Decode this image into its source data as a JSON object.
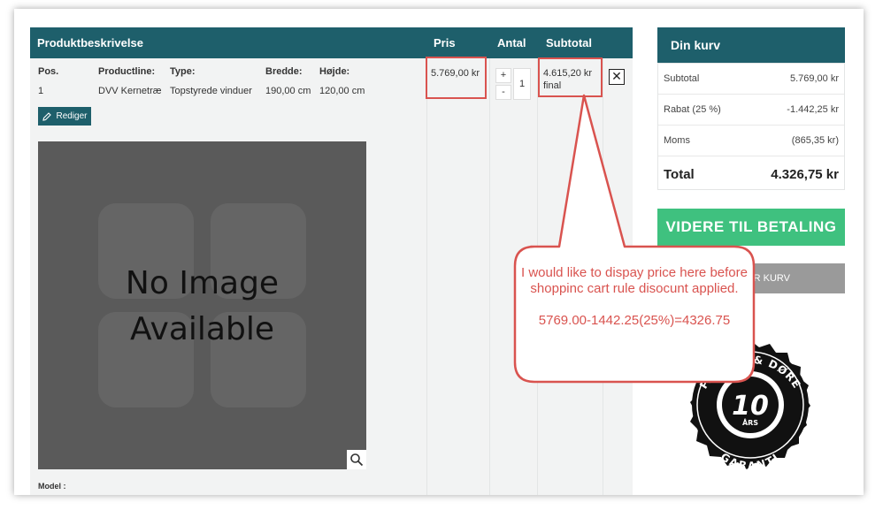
{
  "table": {
    "headers": {
      "product": "Produktbeskrivelse",
      "price": "Pris",
      "qty": "Antal",
      "subtotal": "Subtotal"
    },
    "columns": {
      "pos": "Pos.",
      "productline": "Productline:",
      "type": "Type:",
      "width": "Bredde:",
      "height": "Højde:"
    },
    "row": {
      "pos": "1",
      "productline": "DVV Kernetræ",
      "type": "Topstyrede vinduer",
      "width": "190,00 cm",
      "height": "120,00 cm",
      "price": "5.769,00 kr",
      "quantity": "1",
      "subtotal_line1": "4.615,20 kr",
      "subtotal_line2": "final"
    },
    "edit_label": "Rediger",
    "qty_plus": "+",
    "qty_minus": "-",
    "delete_glyph": "✕",
    "no_image_line1": "No Image",
    "no_image_line2": "Available",
    "model_label": "Model :"
  },
  "cart": {
    "title": "Din kurv",
    "rows": [
      {
        "label": "Subtotal",
        "value": "5.769,00 kr"
      },
      {
        "label": "Rabat (25 %)",
        "value": "-1.442,25 kr"
      },
      {
        "label": "Moms",
        "value": "(865,35 kr)"
      }
    ],
    "total_label": "Total",
    "total_value": "4.326,75 kr",
    "checkout_label": "VIDERE TIL BETALING",
    "secondary_label": "R KURV"
  },
  "callout": {
    "line1": "I would like to dispay price here before shoppinc cart rule disocunt applied.",
    "line2": "5769.00-1442.25(25%)=4326.75"
  },
  "badge": {
    "center": "10",
    "years": "ÅRS",
    "top_arc": "P... UER & DØRE",
    "bottom_arc": "GARANTI"
  },
  "colors": {
    "header": "#1e5f6b",
    "checkout": "#3fc17f",
    "highlight": "#d9534f"
  }
}
